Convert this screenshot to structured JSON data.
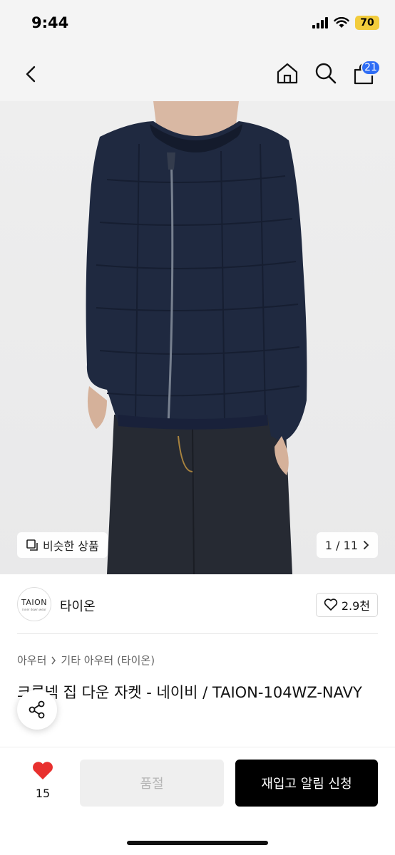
{
  "status": {
    "time": "9:44",
    "battery": "70"
  },
  "nav": {
    "cart_count": "21"
  },
  "gallery": {
    "similar_label": "비슷한 상품",
    "pager": "1 / 11"
  },
  "brand": {
    "logo_text": "TAION",
    "logo_sub": "inner down wear",
    "name": "타이온",
    "wish_count": "2.9천"
  },
  "breadcrumb": {
    "level1": "아우터",
    "level2": "기타 아우터 (타이온)"
  },
  "product": {
    "title": "크루넥 집 다운 자켓 - 네이비 / TAION-104WZ-NAVY"
  },
  "actions": {
    "like_count": "15",
    "soldout_label": "품절",
    "restock_label": "재입고 알림 신청"
  },
  "colors": {
    "badge": "#2f6df5",
    "heart": "#e8302e",
    "battery": "#f2cc3c"
  }
}
